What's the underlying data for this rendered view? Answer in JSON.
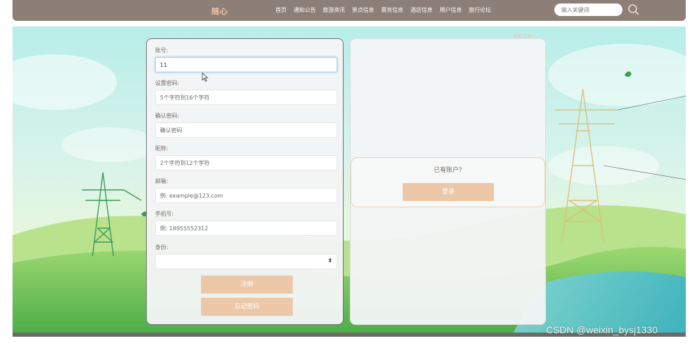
{
  "header": {
    "brand": "随心",
    "nav": [
      "首页",
      "通知公告",
      "旅游资讯",
      "景点信息",
      "票务信息",
      "酒店信息",
      "用户信息",
      "旅行论坛"
    ],
    "search_placeholder": "输入关键词"
  },
  "form": {
    "fields": [
      {
        "label": "账号:",
        "value": "11",
        "placeholder": ""
      },
      {
        "label": "设置密码:",
        "value": "",
        "placeholder": "5个字符到16个字符"
      },
      {
        "label": "确认密码:",
        "value": "",
        "placeholder": "确认密码"
      },
      {
        "label": "昵称:",
        "value": "",
        "placeholder": "2个字符到12个字符"
      },
      {
        "label": "邮箱:",
        "value": "",
        "placeholder": "例: example@123.com"
      },
      {
        "label": "手机号:",
        "value": "",
        "placeholder": "例: 18955552312"
      }
    ],
    "identity_label": "身份:",
    "identity_value": "",
    "register_label": "注册",
    "forgot_label": "忘记密码"
  },
  "login_panel": {
    "have_account": "已有账户?",
    "login_label": "登录"
  },
  "faint_link": "登录 注册",
  "watermark": "CSDN @weixin_bysj1330",
  "colors": {
    "topbar": "#8c7f77",
    "button": "#ecc8a8",
    "brand": "#f2c2a2"
  }
}
